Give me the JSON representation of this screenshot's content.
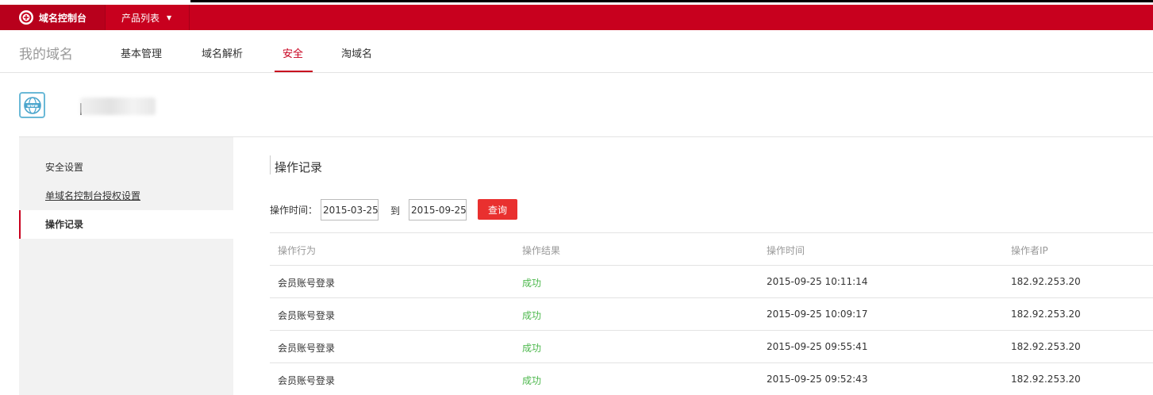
{
  "topbar": {
    "brand": "域名控制台",
    "products": "产品列表"
  },
  "nav": {
    "title": "我的域名",
    "tabs": [
      {
        "label": "基本管理",
        "active": false
      },
      {
        "label": "域名解析",
        "active": false
      },
      {
        "label": "安全",
        "active": true
      },
      {
        "label": "淘域名",
        "active": false
      }
    ]
  },
  "sidebar": {
    "items": [
      {
        "label": "安全设置"
      },
      {
        "label": "单域名控制台授权设置"
      },
      {
        "label": "操作记录"
      }
    ]
  },
  "main": {
    "title": "操作记录",
    "filter": {
      "label": "操作时间：",
      "from": "2015-03-25",
      "to_label": "到",
      "to": "2015-09-25",
      "query": "查询"
    },
    "table": {
      "headers": [
        "操作行为",
        "操作结果",
        "操作时间",
        "操作者IP"
      ],
      "rows": [
        [
          "会员账号登录",
          "成功",
          "2015-09-25 10:11:14",
          "182.92.253.20"
        ],
        [
          "会员账号登录",
          "成功",
          "2015-09-25 10:09:17",
          "182.92.253.20"
        ],
        [
          "会员账号登录",
          "成功",
          "2015-09-25 09:55:41",
          "182.92.253.20"
        ],
        [
          "会员账号登录",
          "成功",
          "2015-09-25 09:52:43",
          "182.92.253.20"
        ]
      ]
    }
  },
  "colors": {
    "brand": "#c8001e",
    "success": "#4db84d",
    "button": "#e9302f"
  },
  "icons": {
    "logo": "cloud-logo-icon",
    "caret": "chevron-down-icon",
    "domain": "www-globe-icon"
  }
}
